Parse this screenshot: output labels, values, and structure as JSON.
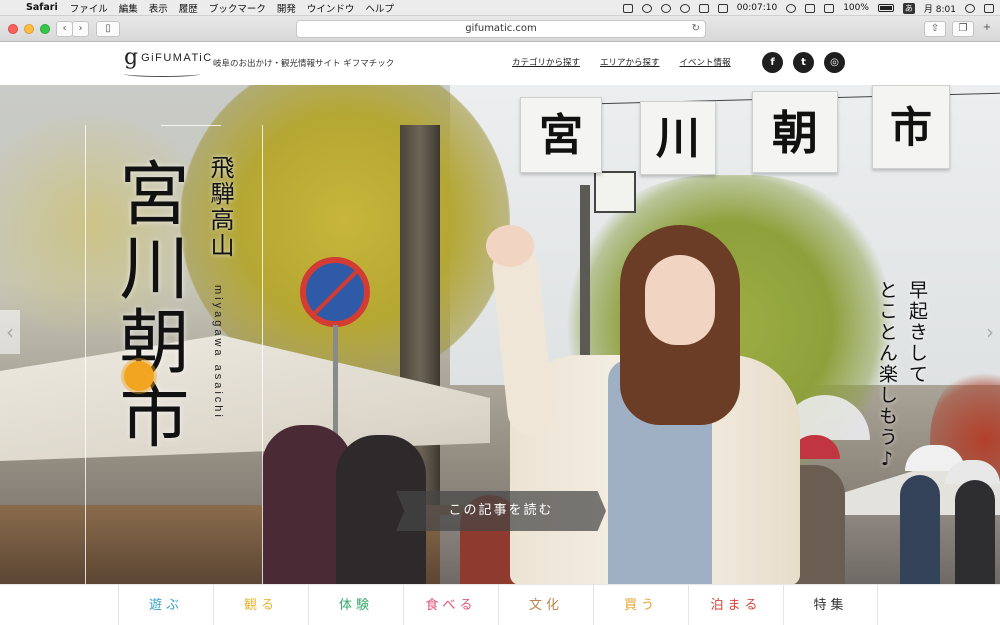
{
  "menubar": {
    "app": "Safari",
    "items": [
      "ファイル",
      "編集",
      "表示",
      "履歴",
      "ブックマーク",
      "開発",
      "ウインドウ",
      "ヘルプ"
    ],
    "timer": "00:07:10",
    "battery": "100%",
    "ime": "あ",
    "clock": "月 8:01"
  },
  "browser": {
    "url": "gifumatic.com"
  },
  "site": {
    "logo_text": "GiFUMATiC",
    "tagline": "岐阜のお出かけ・観光情報サイト ギフマチック",
    "nav": [
      "カテゴリから探す",
      "エリアから探す",
      "イベント情報"
    ],
    "social": [
      {
        "name": "facebook",
        "glyph": "f"
      },
      {
        "name": "twitter",
        "glyph": "t"
      },
      {
        "name": "instagram",
        "glyph": "◎"
      }
    ]
  },
  "hero": {
    "banners": [
      "宮",
      "川",
      "朝",
      "市"
    ],
    "title_main": "宮川朝市",
    "title_sub": "飛騨高山",
    "romaji": "miyagawa asaichi",
    "catch_lines": [
      "早起きして",
      "とことん楽しもう♪"
    ],
    "read_more": "この記事を読む",
    "prev": "‹",
    "next": "›"
  },
  "categories": [
    {
      "label": "遊ぶ",
      "color": "#3aa1c8"
    },
    {
      "label": "観る",
      "color": "#e6b631"
    },
    {
      "label": "体験",
      "color": "#39a86b"
    },
    {
      "label": "食べる",
      "color": "#e2557a"
    },
    {
      "label": "文化",
      "color": "#b8864a"
    },
    {
      "label": "買う",
      "color": "#e6a231"
    },
    {
      "label": "泊まる",
      "color": "#d9433a"
    },
    {
      "label": "特集",
      "color": "#333333"
    }
  ]
}
